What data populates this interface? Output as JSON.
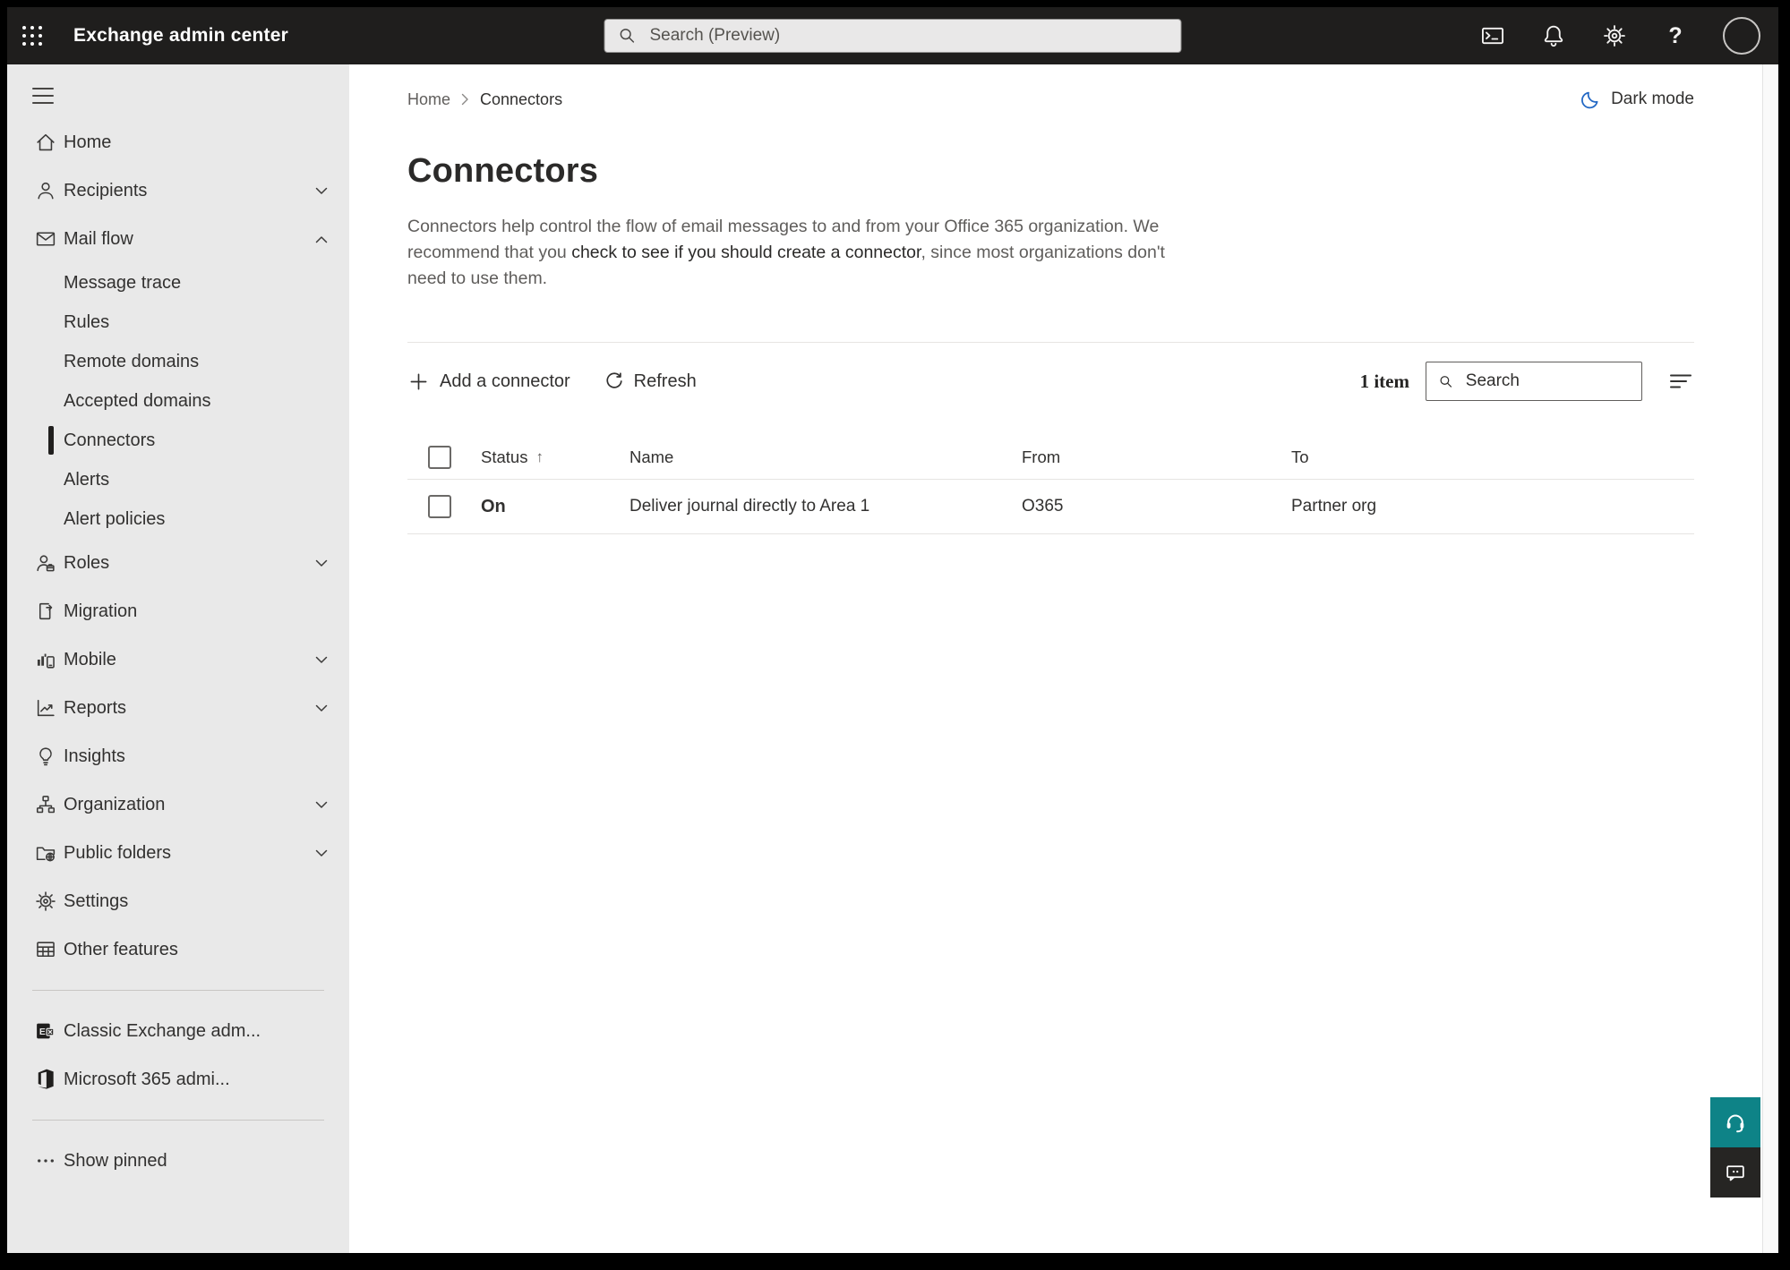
{
  "topbar": {
    "app_title": "Exchange admin center",
    "search_placeholder": "Search (Preview)"
  },
  "sidebar": {
    "top": [
      {
        "label": "Home"
      },
      {
        "label": "Recipients"
      },
      {
        "label": "Mail flow"
      }
    ],
    "mailflow_children": [
      {
        "label": "Message trace"
      },
      {
        "label": "Rules"
      },
      {
        "label": "Remote domains"
      },
      {
        "label": "Accepted domains"
      },
      {
        "label": "Connectors"
      },
      {
        "label": "Alerts"
      },
      {
        "label": "Alert policies"
      }
    ],
    "bottom": [
      {
        "label": "Roles"
      },
      {
        "label": "Migration"
      },
      {
        "label": "Mobile"
      },
      {
        "label": "Reports"
      },
      {
        "label": "Insights"
      },
      {
        "label": "Organization"
      },
      {
        "label": "Public folders"
      },
      {
        "label": "Settings"
      },
      {
        "label": "Other features"
      }
    ],
    "footer": [
      {
        "label": "Classic Exchange adm..."
      },
      {
        "label": "Microsoft 365 admi..."
      }
    ],
    "show_pinned": "Show pinned"
  },
  "breadcrumb": {
    "home": "Home",
    "current": "Connectors"
  },
  "dark_mode_label": "Dark mode",
  "page": {
    "title": "Connectors",
    "description_1": "Connectors help control the flow of email messages to and from your Office 365 organization. We recommend that you ",
    "description_link": "check to see if you should create a connector",
    "description_2": ", since most organizations don't need to use them."
  },
  "toolbar": {
    "add_label": "Add a connector",
    "refresh_label": "Refresh",
    "item_count": "1 item",
    "search_placeholder": "Search"
  },
  "table": {
    "headers": {
      "status": "Status",
      "name": "Name",
      "from": "From",
      "to": "To"
    },
    "sort_indicator": "↑",
    "rows": [
      {
        "status": "On",
        "name": "Deliver journal directly to Area 1",
        "from": "O365",
        "to": "Partner org"
      }
    ]
  },
  "colors": {
    "topbar_bg": "#1f1e1d",
    "sidebar_bg": "#e9e9e9",
    "accent_blue": "#2368c4",
    "teal_fab": "#0e8387"
  }
}
